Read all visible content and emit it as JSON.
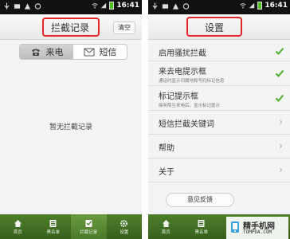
{
  "colors": {
    "accent_green": "#4f7f2c",
    "highlight_red": "#e4262b",
    "check_green": "#4caf2a"
  },
  "left_screen": {
    "status": {
      "time": "16:41"
    },
    "title": "拦截记录",
    "clear_button": "清空",
    "tabs": [
      {
        "label": "来电",
        "icon": "incoming-call-icon",
        "active": true
      },
      {
        "label": "短信",
        "icon": "sms-icon",
        "active": false
      }
    ],
    "empty_message": "暂无拦截记录",
    "nav": [
      {
        "label": "首页",
        "icon": "home-icon"
      },
      {
        "label": "黑名单",
        "icon": "blacklist-icon"
      },
      {
        "label": "拦截记录",
        "icon": "records-icon",
        "active": true
      },
      {
        "label": "设置",
        "icon": "gear-icon"
      }
    ]
  },
  "right_screen": {
    "status": {
      "time": "16:41"
    },
    "title": "设置",
    "settings": [
      {
        "label": "启用骚扰拦截",
        "checked": true
      },
      {
        "label": "来去电提示框",
        "sub": "通话时显示归属地和号码标记信息",
        "checked": true
      },
      {
        "label": "标记提示框",
        "sub": "接听陌生来电后，显示标记提示",
        "checked": true
      },
      {
        "label": "短信拦截关键词"
      },
      {
        "label": "帮助"
      },
      {
        "label": "关于"
      }
    ],
    "feedback_button": "意见反馈",
    "nav": [
      {
        "label": "首页"
      },
      {
        "label": "黑名单"
      }
    ],
    "watermark": {
      "line1": "精手机网",
      "line2": "TOMPDA.COM"
    }
  }
}
